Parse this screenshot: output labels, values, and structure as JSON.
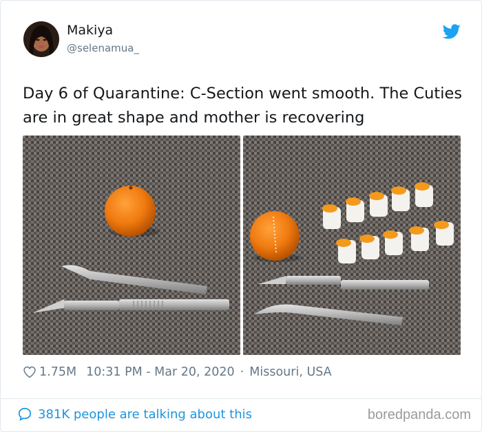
{
  "tweet": {
    "author_name": "Makiya",
    "author_handle": "@selenamua_",
    "text": "Day 6 of Quarantine: C-Section went smooth. The Cuties are in great shape and mother is recovering",
    "likes": "1.75M",
    "timestamp": "10:31 PM - Mar 20, 2020",
    "location_separator": "·",
    "location": "Missouri, USA",
    "talking": "381K people are talking about this"
  },
  "icons": {
    "platform": "bird-icon",
    "like": "heart-icon",
    "comment": "speech-bubble-icon"
  },
  "colors": {
    "accent": "#1da1f2",
    "link": "#1b95e0",
    "muted": "#657786",
    "text": "#14171a"
  },
  "watermark": "boredpanda.com"
}
